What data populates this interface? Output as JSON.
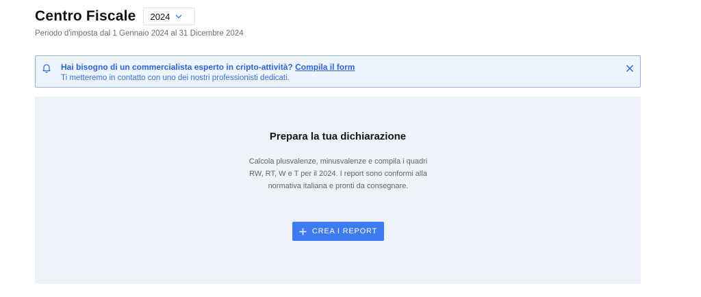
{
  "header": {
    "title": "Centro Fiscale",
    "year_selected": "2024",
    "subtitle": "Periodo d'imposta dal 1 Gennaio 2024 al 31 Dicembre 2024"
  },
  "banner": {
    "question": "Hai bisogno di un commercialista esperto in cripto-attività?",
    "link_text": "Compila il form",
    "message": "Ti metteremo in contatto con uno dei nostri professionisti dedicati.",
    "icons": [
      "bell-icon",
      "close-icon"
    ]
  },
  "panel": {
    "title": "Prepara la tua dichiarazione",
    "description": "Calcola plusvalenze, minusvalenze e compila i quadri RW, RT, W e T per il 2024. I report sono conformi alla normativa italiana e pronti da consegnare.",
    "button_label": "CREA I REPORT",
    "button_icon": "plus-icon"
  },
  "colors": {
    "accent": "#3d7bf2",
    "banner_text": "#2c64d8",
    "banner_bg": "#eef4fd",
    "panel_bg": "#eef3fb"
  }
}
